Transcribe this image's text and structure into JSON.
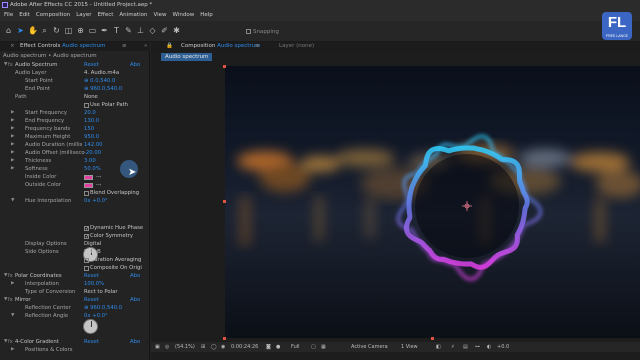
{
  "window": {
    "title": "Adobe After Effects CC 2015 - Untitled Project.aep *"
  },
  "menu": [
    "File",
    "Edit",
    "Composition",
    "Layer",
    "Effect",
    "Animation",
    "View",
    "Window",
    "Help"
  ],
  "toolbar": {
    "snapping_label": "Snapping"
  },
  "logo": {
    "letters": "FL",
    "sub": "FREE LANCE"
  },
  "effect_controls": {
    "tab_prefix": "Effect Controls",
    "tab_layer": "Audio spectrum",
    "breadcrumb": "Audio spectrum • Audio spectrum",
    "audio_spectrum": {
      "name": "Audio Spectrum",
      "reset": "Reset",
      "about": "Abo",
      "audio_layer_label": "Audio Layer",
      "audio_layer_value": "4. Audio.m4a",
      "start_point_label": "Start Point",
      "start_point_value": "0.0,540.0",
      "end_point_label": "End Point",
      "end_point_value": "960.0,540.0",
      "path_label": "Path",
      "path_value": "None",
      "use_polar_path_label": "Use Polar Path",
      "start_frequency_label": "Start Frequency",
      "start_frequency_value": "20.0",
      "end_frequency_label": "End Frequency",
      "end_frequency_value": "130.0",
      "frequency_bands_label": "Frequency bands",
      "frequency_bands_value": "150",
      "maximum_height_label": "Maximum Height",
      "maximum_height_value": "950.0",
      "audio_duration_label": "Audio Duration (millis",
      "audio_duration_value": "142.00",
      "audio_offset_label": "Audio Offset (milliseco",
      "audio_offset_value": "-20.00",
      "thickness_label": "Thickness",
      "thickness_value": "3.00",
      "softness_label": "Softness",
      "softness_value": "50.0%",
      "inside_color_label": "Inside Color",
      "outside_color_label": "Outside Color",
      "blend_overlapping_label": "Blend Overlapping",
      "hue_interpolation_label": "Hue Interpolation",
      "hue_interpolation_value": "0x +0.0°",
      "dynamic_hue_phase_label": "Dynamic Hue Phase",
      "color_symmetry_label": "Color Symmetry",
      "display_options_label": "Display Options",
      "display_options_value": "Digital",
      "side_options_label": "Side Options",
      "side_options_value": "Side B",
      "duration_averaging_label": "Duration Averaging",
      "composite_on_original_label": "Composite On Origi"
    },
    "polar_coordinates": {
      "name": "Polar Coordinates",
      "reset": "Reset",
      "about": "Abo",
      "interpolation_label": "Interpolation",
      "interpolation_value": "100.0%",
      "type_of_conversion_label": "Type of Conversion",
      "type_of_conversion_value": "Rect to Polar"
    },
    "mirror": {
      "name": "Mirror",
      "reset": "Reset",
      "about": "Abo",
      "reflection_center_label": "Reflection Center",
      "reflection_center_value": "960.0,540.0",
      "reflection_angle_label": "Reflection Angle",
      "reflection_angle_value": "0x +0.0°"
    },
    "gradient": {
      "name": "4-Color Gradient",
      "reset": "Reset",
      "about": "Abo",
      "positions_colors_label": "Positions & Colors"
    }
  },
  "composition": {
    "tab_prefix": "Composition",
    "tab_name": "Audio spectrum",
    "layer_tab": "Layer (none)",
    "subtab": "Audio spectrum"
  },
  "viewer_bar": {
    "zoom": "(54.1%)",
    "timecode": "0:00:24:26",
    "resolution": "Full",
    "camera": "Active Camera",
    "view": "1 View",
    "exposure": "+0.0"
  },
  "colors": {
    "accent": "#2d8ceb",
    "inside_color": "#e33fa3",
    "ring_top": "#2fc6ff",
    "ring_bottom": "#e23ee8"
  }
}
